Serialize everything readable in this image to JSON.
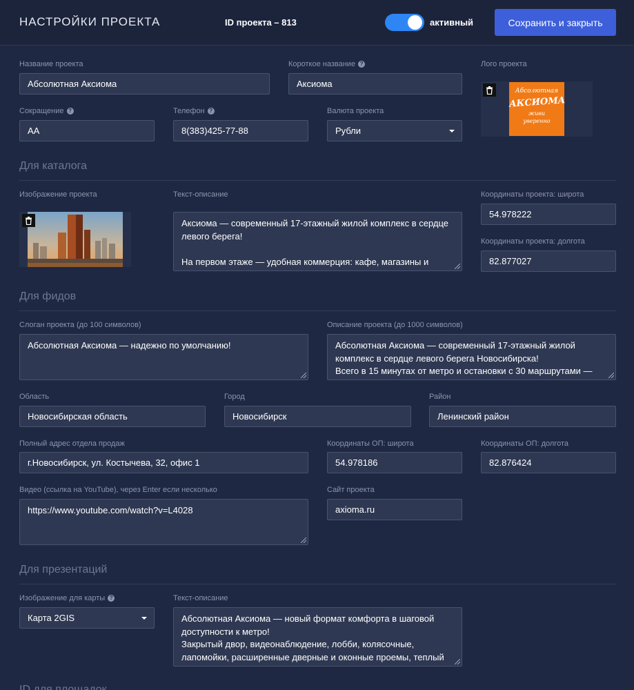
{
  "header": {
    "title": "НАСТРОЙКИ ПРОЕКТА",
    "project_id": "ID проекта – 813",
    "toggle_label": "активный",
    "toggle_on": true,
    "save_label": "Сохранить и закрыть"
  },
  "general": {
    "name_label": "Название проекта",
    "name_value": "Абсолютная Аксиома",
    "short_name_label": "Короткое название",
    "short_name_value": "Аксиома",
    "logo_label": "Лого проекта",
    "logo_text": [
      "Абсолютная",
      "АКСИОМА",
      "живи",
      "уверенно"
    ],
    "abbr_label": "Сокращение",
    "abbr_value": "АА",
    "phone_label": "Телефон",
    "phone_value": "8(383)425-77-88",
    "currency_label": "Валюта проекта",
    "currency_value": "Рубли"
  },
  "catalog": {
    "section_title": "Для каталога",
    "image_label": "Изображение проекта",
    "description_label": "Текст-описание",
    "description_value": "Аксиома — современный 17-этажный жилой комплекс в сердце левого берега!\n\nНа первом этаже — удобная коммерция: кафе, магазины и",
    "lat_label": "Координаты проекта: широта",
    "lat_value": "54.978222",
    "lon_label": "Координаты проекта: долгота",
    "lon_value": "82.877027"
  },
  "feeds": {
    "section_title": "Для фидов",
    "slogan_label": "Слоган проекта (до 100 символов)",
    "slogan_value": "Абсолютная Аксиома — надежно по умолчанию!",
    "description_label": "Описание проекта (до 1000 символов)",
    "description_value": "Абсолютная Аксиома — современный 17-этажный жилой комплекс в сердце левого берега Новосибирска!\nВсего в 15 минутах от метро и остановки с 30 маршрутами —",
    "region_label": "Область",
    "region_value": "Новосибирская область",
    "city_label": "Город",
    "city_value": "Новосибирск",
    "district_label": "Район",
    "district_value": "Ленинский район",
    "address_label": "Полный адрес отдела продаж",
    "address_value": "г.Новосибирск, ул. Костычева, 32, офис 1",
    "office_lat_label": "Координаты ОП: широта",
    "office_lat_value": "54.978186",
    "office_lon_label": "Координаты ОП: долгота",
    "office_lon_value": "82.876424",
    "video_label": "Видео (ссылка на YouTube), через Enter если несколько",
    "video_value": "https://www.youtube.com/watch?v=L4028",
    "site_label": "Сайт проекта",
    "site_value": "axioma.ru"
  },
  "presentations": {
    "section_title": "Для презентаций",
    "map_image_label": "Изображение для карты",
    "map_image_value": "Карта 2GIS",
    "description_label": "Текст-описание",
    "description_value": "Абсолютная Аксиома — новый формат комфорта в шаговой доступности к метро!\nЗакрытый двор, видеонаблюдение, лобби, колясочные, лапомойки, расширенные дверные и оконные проемы, теплый"
  },
  "next_section_title": "ID для площадок",
  "colors": {
    "background": "#1f2842",
    "accent": "#3d5fd9",
    "toggle": "#2e86f5",
    "logo_orange": "#f07a16"
  }
}
